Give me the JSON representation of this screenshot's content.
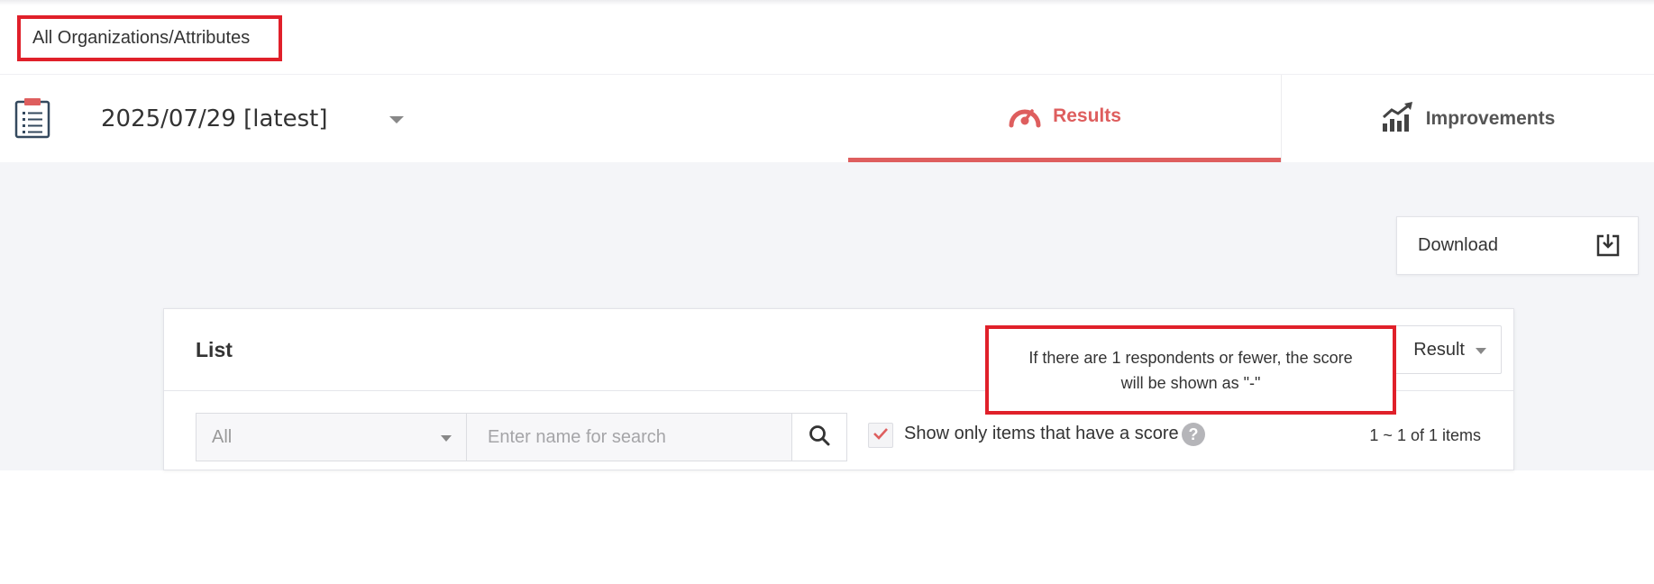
{
  "breadcrumb": {
    "label": "All Organizations/Attributes"
  },
  "header": {
    "survey_icon": "clipboard-list-icon",
    "date_select": {
      "value": "2025/07/29 [latest]"
    },
    "tabs": [
      {
        "label": "Results",
        "icon": "gauge-icon",
        "active": true
      },
      {
        "label": "Improvements",
        "icon": "trending-up-chart-icon",
        "active": false
      }
    ]
  },
  "toolbar": {
    "download_label": "Download",
    "download_icon": "download-tray-icon"
  },
  "list_panel": {
    "title": "List",
    "result_select": {
      "value": "Result"
    },
    "filter_select": {
      "value": "All"
    },
    "search": {
      "placeholder": "Enter name for search",
      "value": ""
    },
    "score_filter": {
      "label": "Show only items that have a score",
      "checked": true
    },
    "help_glyph": "?",
    "items_count": "1 ~ 1 of 1 items"
  },
  "tooltip": {
    "text": "If there are 1 respondents or fewer, the score will be shown as \"-\""
  },
  "colors": {
    "accent": "#de5e5e",
    "highlight_border": "#e0202a",
    "content_background": "#f4f5f8",
    "icon_dark": "#34495e"
  }
}
